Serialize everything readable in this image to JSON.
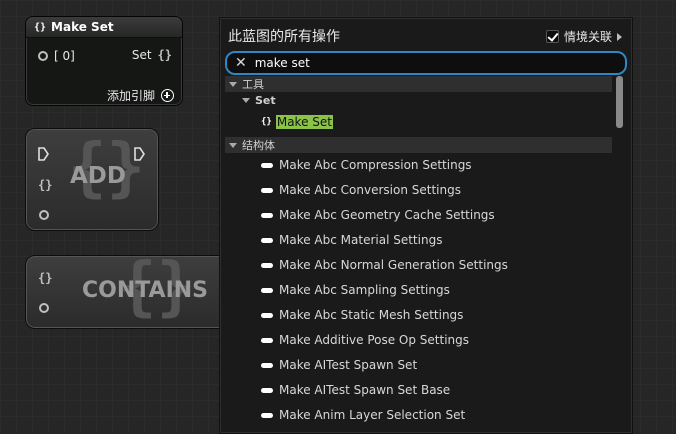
{
  "nodes": {
    "make_set": {
      "title": "Make Set",
      "icon": "set-icon",
      "input_label": "[ 0]",
      "output_label": "Set",
      "output_icon": "{}",
      "add_pin_label": "添加引脚"
    },
    "add": {
      "label": "ADD",
      "pin_icon": "{}"
    },
    "contains": {
      "label": "CONTAINS",
      "pin_icon": "{}"
    }
  },
  "menu": {
    "title": "此蓝图的所有操作",
    "context_label": "情境关联",
    "context_checked": true,
    "search_value": "make set",
    "categories": [
      {
        "label": "工具",
        "subcategory": "Set",
        "items": [
          "Make Set"
        ]
      },
      {
        "label": "结构体"
      }
    ],
    "struct_items": [
      "Make Abc Compression Settings",
      "Make Abc Conversion Settings",
      "Make Abc Geometry Cache Settings",
      "Make Abc Material Settings",
      "Make Abc Normal Generation Settings",
      "Make Abc Sampling Settings",
      "Make Abc Static Mesh Settings",
      "Make Additive Pose Op Settings",
      "Make AITest Spawn Set",
      "Make AITest Spawn Set Base",
      "Make Anim Layer Selection Set"
    ]
  },
  "colors": {
    "highlight": "#8bc34a",
    "search_border": "#2f86c4"
  }
}
